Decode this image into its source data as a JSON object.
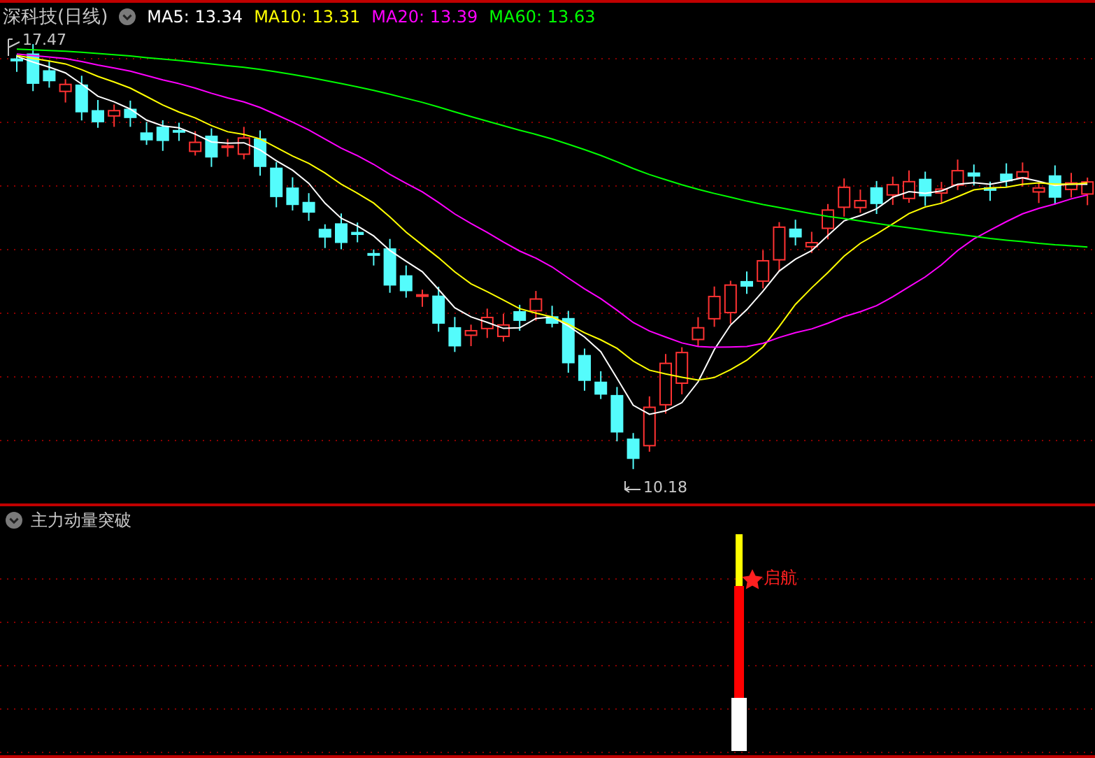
{
  "title": "深科技(日线)",
  "moving_averages": [
    {
      "label": "MA5: 13.34",
      "color": "#ffffff"
    },
    {
      "label": "MA10: 13.31",
      "color": "#ffff00"
    },
    {
      "label": "MA20: 13.39",
      "color": "#ff00ff"
    },
    {
      "label": "MA60: 13.63",
      "color": "#00ff00"
    }
  ],
  "price_chart": {
    "high_label": "17.47",
    "low_label": "10.18"
  },
  "indicator": {
    "title": "主力动量突破",
    "signal_label": "启航"
  }
}
